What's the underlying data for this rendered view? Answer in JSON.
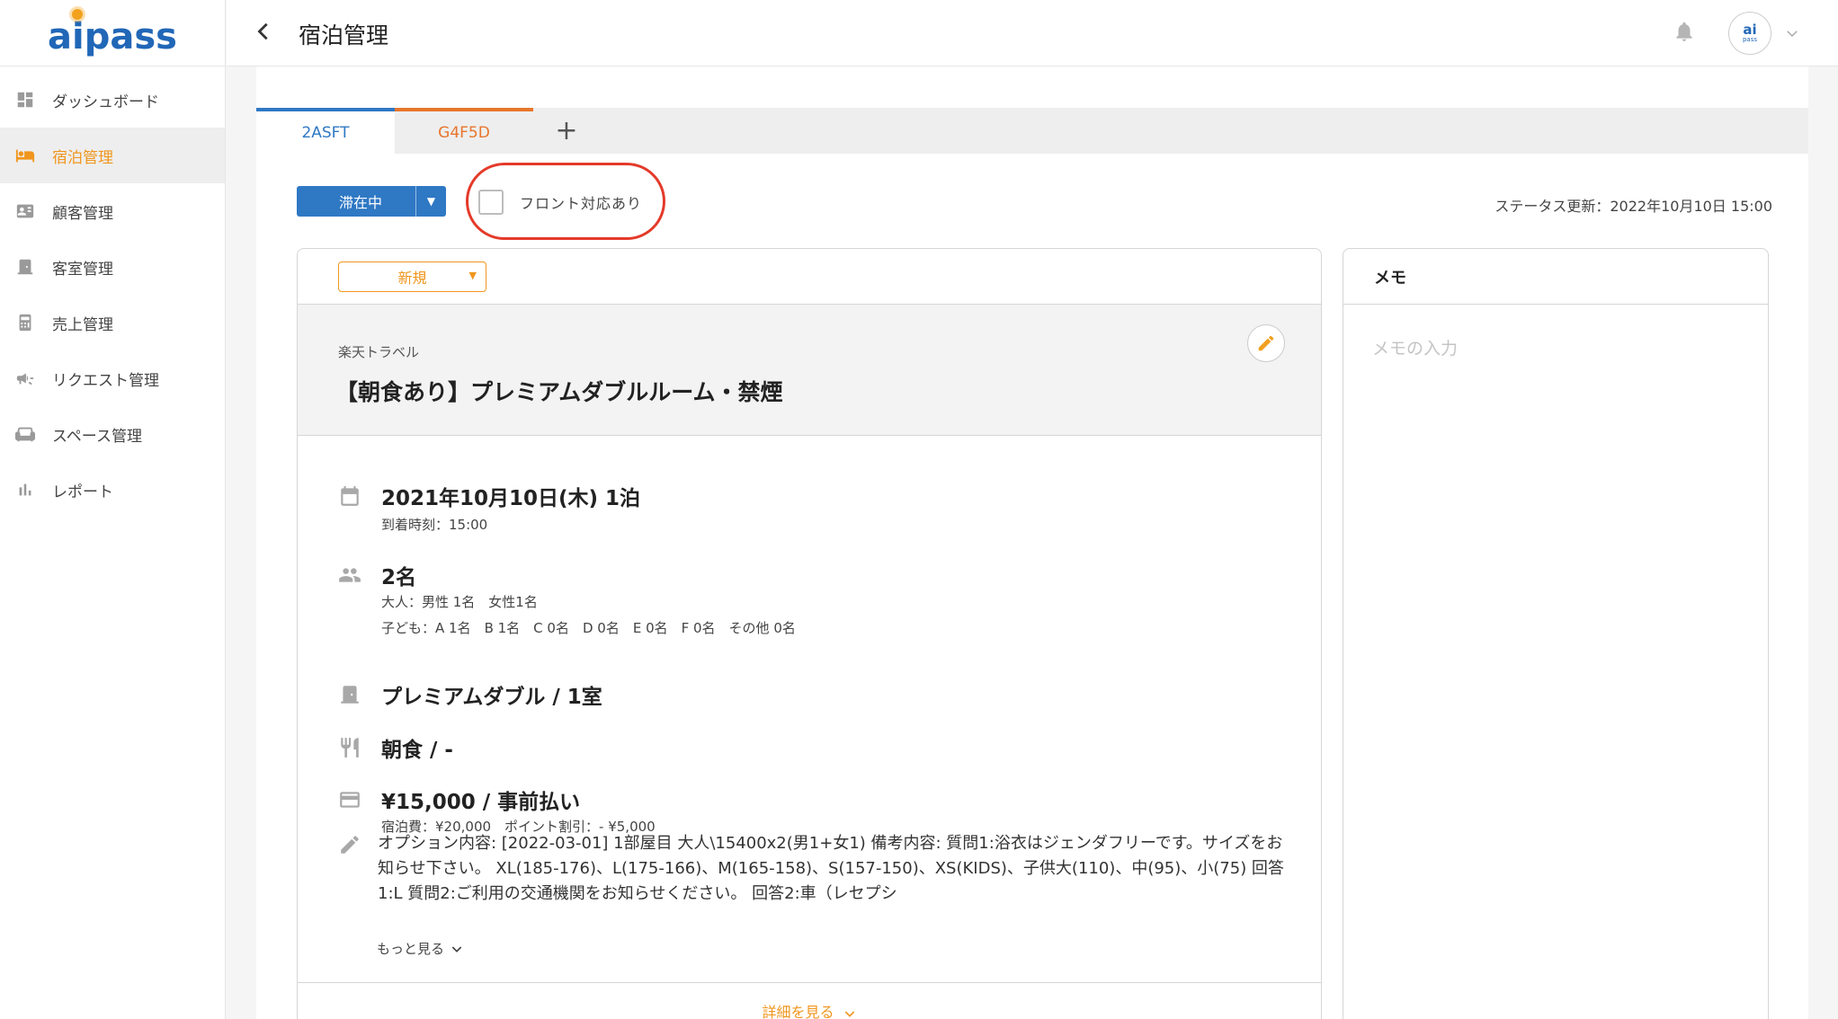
{
  "app": {
    "logo": "aipass"
  },
  "sidebar": {
    "items": [
      {
        "label": "ダッシュボード",
        "icon": "dashboard-icon",
        "active": false
      },
      {
        "label": "宿泊管理",
        "icon": "bed-icon",
        "active": true
      },
      {
        "label": "顧客管理",
        "icon": "customer-card-icon",
        "active": false
      },
      {
        "label": "客室管理",
        "icon": "door-icon",
        "active": false
      },
      {
        "label": "売上管理",
        "icon": "calculator-icon",
        "active": false
      },
      {
        "label": "リクエスト管理",
        "icon": "megaphone-icon",
        "active": false
      },
      {
        "label": "スペース管理",
        "icon": "sofa-icon",
        "active": false
      },
      {
        "label": "レポート",
        "icon": "bar-chart-icon",
        "active": false
      }
    ]
  },
  "header": {
    "title": "宿泊管理",
    "avatar_text": "ai",
    "avatar_sub": "pass"
  },
  "tabs": [
    {
      "label": "2ASFT",
      "color": "#2f78c4",
      "active": true
    },
    {
      "label": "G4F5D",
      "color": "#e8762c",
      "active": false
    }
  ],
  "tab_add_label": "+",
  "status": {
    "label": "滞在中",
    "front_label": "フロント対応あり",
    "front_checked": false,
    "updated": "ステータス更新：2022年10月10日 15:00"
  },
  "reservation": {
    "type_select": "新規",
    "agency": "楽天トラベル",
    "plan": "【朝食あり】プレミアムダブルルーム・禁煙",
    "date": "2021年10月10日(木) 1泊",
    "arrival": "到着時刻：15:00",
    "guests": "2名",
    "adults": "大人：男性 1名　女性1名",
    "children": "子ども：A 1名　B 1名　C 0名　D 0名　E 0名　F 0名　その他 0名",
    "room": "プレミアムダブル / 1室",
    "meal": "朝食 / -",
    "price": "¥15,000 / 事前払い",
    "price_detail": "宿泊費：¥20,000　ポイント割引：- ¥5,000",
    "note": "オプション内容: [2022-03-01] 1部屋目 大人\\15400x2(男1+女1) 備考内容: 質問1:浴衣はジェンダフリーです。サイズをお知らせ下さい。 XL(185-176)、L(175-166)、M(165-158)、S(157-150)、XS(KIDS)、子供大(110)、中(95)、小(75) 回答1:L 質問2:ご利用の交通機関をお知らせください。 回答2:車（レセプシ",
    "more": "もっと見る",
    "detail_link": "詳細を見る"
  },
  "memo": {
    "title": "メモ",
    "placeholder": "メモの入力",
    "value": ""
  },
  "colors": {
    "brand": "#2167b7",
    "accent": "#f0961e",
    "status_blue": "#2f78c4",
    "highlight": "#e43a2a"
  }
}
